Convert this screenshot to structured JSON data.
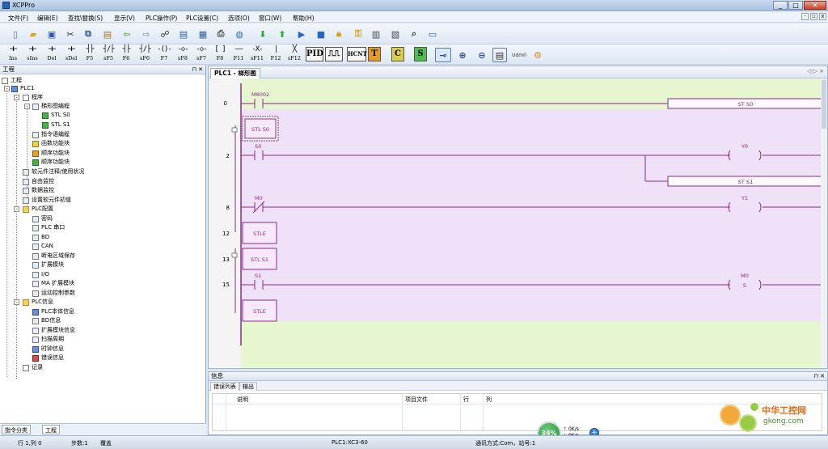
{
  "window": {
    "title": "XCPPro",
    "minimize": "_",
    "maximize": "□",
    "close": "✕"
  },
  "menu": [
    "文件(F)",
    "编辑(E)",
    "查找\\替换(S)",
    "显示(V)",
    "PLC操作(P)",
    "PLC设置(C)",
    "选项(O)",
    "窗口(W)",
    "帮助(H)"
  ],
  "toolbar2": {
    "buttons": [
      "Ins",
      "sIns",
      "Del",
      "sDel",
      "F5",
      "sF5",
      "F6",
      "sF6",
      "F7",
      "sF8",
      "sF7",
      "F8",
      "F11",
      "sF11",
      "F12",
      "sF12"
    ],
    "boxes": [
      "PID",
      "HCNT",
      "T",
      "C",
      "S",
      "Udm0"
    ]
  },
  "project": {
    "title": "工程",
    "tree": [
      "工程",
      "PLC1",
      "程序",
      "梯形图编程",
      "STL S0",
      "STL S1",
      "指令语编程",
      "函数功能块",
      "顺序功能块",
      "顺序功能块",
      "软元件注释/使用状况",
      "自由监控",
      "数据监控",
      "设置软元件初值",
      "PLC配置",
      "密码",
      "PLC 串口",
      "BD",
      "CAN",
      "断电区域保存",
      "扩展模块",
      "I/O",
      "MA 扩展模块",
      "运动控制参数",
      "PLC信息",
      "PLC本体信息",
      "BD信息",
      "扩展模块信息",
      "扫描周期",
      "时钟信息",
      "错误信息",
      "记录"
    ],
    "tabs": [
      "指令分类",
      "工程"
    ]
  },
  "ladder": {
    "tab_title": "PLC1 - 梯形图",
    "nav": "◁ ▷ ×",
    "rungs": [
      {
        "step": "0",
        "contact": "M8002",
        "output": "ST      S0"
      },
      {
        "step": "",
        "block": "STL S0"
      },
      {
        "step": "2",
        "contact": "S0",
        "coil": "Y0",
        "output": "ST      S1"
      },
      {
        "step": "8",
        "contact": "M0",
        "coil": "Y1"
      },
      {
        "step": "12",
        "block": "STLE"
      },
      {
        "step": "13",
        "block": "STL S1"
      },
      {
        "step": "15",
        "contact": "S1",
        "coil": "M0",
        "coil_sub": "S"
      },
      {
        "step": "",
        "block": "STLE"
      }
    ],
    "colors": {
      "green_bg": "#e6f7cf",
      "purple_bg": "#efe2f8",
      "ink": "#8a2b83"
    }
  },
  "info": {
    "title": "信息",
    "tabs": [
      "错误列表",
      "输出"
    ],
    "columns": [
      "说明",
      "项目文件",
      "行",
      "列"
    ]
  },
  "widget": {
    "cpu": "34%",
    "up": "0K/s",
    "down": "0K/s"
  },
  "watermark": {
    "cn": "中华工控网",
    "url": "gkong.com"
  },
  "status": {
    "pos": "行 1,列 0",
    "steps": "步数:1",
    "mode": "覆盖",
    "plc": "PLC1:XC3-60",
    "comm": "通讯方式:Com，站号:1"
  }
}
